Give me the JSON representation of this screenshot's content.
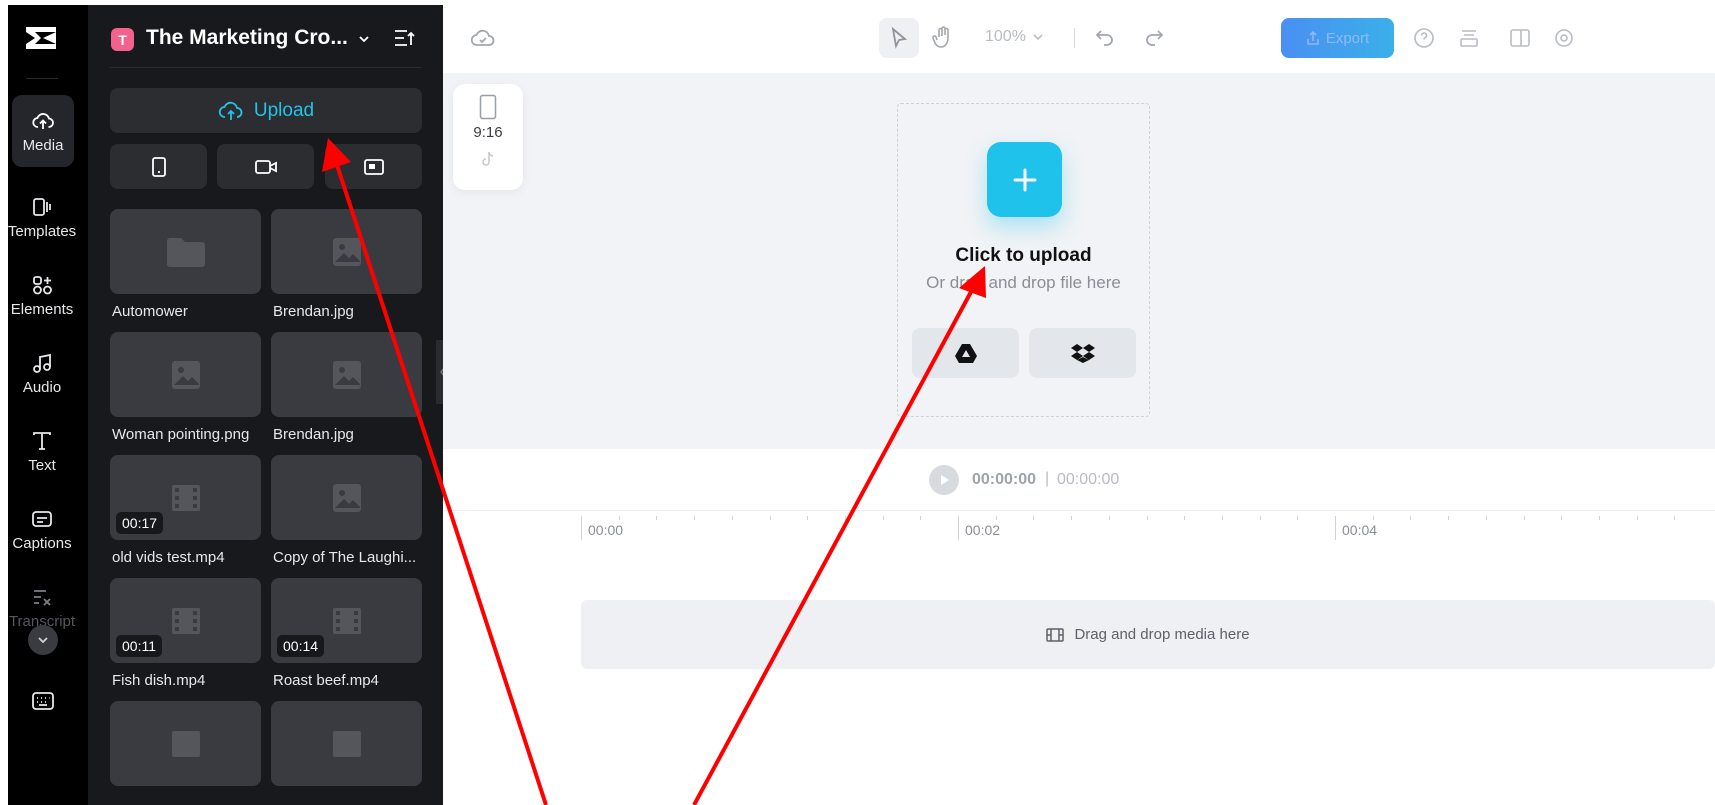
{
  "app": {
    "logo_icon": "capcut-logo-icon",
    "accent_color": "#1fc2ea"
  },
  "rail": {
    "items": [
      {
        "label": "Media",
        "icon": "cloud-upload-icon",
        "active": true
      },
      {
        "label": "Templates",
        "icon": "templates-icon"
      },
      {
        "label": "Elements",
        "icon": "elements-icon"
      },
      {
        "label": "Audio",
        "icon": "music-note-icon"
      },
      {
        "label": "Text",
        "icon": "text-icon"
      },
      {
        "label": "Captions",
        "icon": "captions-icon"
      },
      {
        "label": "Transcript",
        "icon": "transcript-icon"
      }
    ],
    "more_icon": "chevron-down-icon",
    "keyboard_icon": "keyboard-icon"
  },
  "panel": {
    "workspace_badge": "T",
    "workspace_name": "The Marketing Cro...",
    "upload_label": "Upload",
    "format_buttons": [
      "phone-icon",
      "camera-icon",
      "screen-icon"
    ],
    "media": [
      {
        "name": "Automower",
        "kind": "folder",
        "duration": ""
      },
      {
        "name": "Brendan.jpg",
        "kind": "image",
        "duration": ""
      },
      {
        "name": "Woman pointing.png",
        "kind": "image",
        "duration": ""
      },
      {
        "name": "Brendan.jpg",
        "kind": "image",
        "duration": ""
      },
      {
        "name": "old vids test.mp4",
        "kind": "video",
        "duration": "00:17"
      },
      {
        "name": "Copy of The Laughi...",
        "kind": "image",
        "duration": ""
      },
      {
        "name": "Fish dish.mp4",
        "kind": "video",
        "duration": "00:11"
      },
      {
        "name": "Roast beef.mp4",
        "kind": "video",
        "duration": "00:14"
      }
    ]
  },
  "topbar": {
    "zoom": "100%",
    "export_label": "Export"
  },
  "canvas": {
    "ratio": "9:16",
    "upload_title": "Click to upload",
    "upload_subtitle": "Or drag and drop file here",
    "sources": [
      "google-drive-icon",
      "dropbox-icon"
    ]
  },
  "player": {
    "current_time": "00:00:00",
    "separator": "|",
    "total_time": "00:00:00"
  },
  "timeline": {
    "ruler": [
      "00:00",
      "00:02",
      "00:04"
    ],
    "track_hint": "Drag and drop media here"
  }
}
